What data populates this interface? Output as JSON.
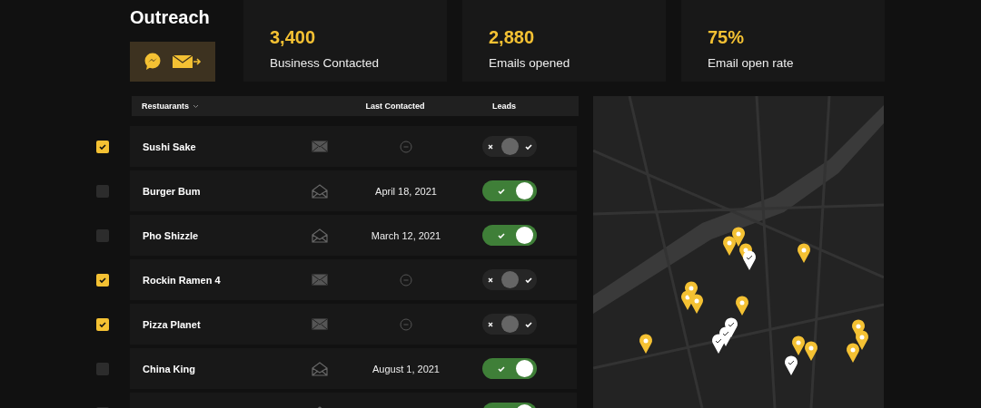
{
  "title": "Outreach",
  "stats": [
    {
      "value": "3,400",
      "label": "Business Contacted"
    },
    {
      "value": "2,880",
      "label": "Emails opened"
    },
    {
      "value": "75%",
      "label": "Email open rate"
    }
  ],
  "table": {
    "columns": [
      "Restuarants",
      "Last Contacted",
      "Leads"
    ],
    "rows": [
      {
        "checked": true,
        "name": "Sushi Sake",
        "opened": false,
        "last_contacted": null,
        "lead": false
      },
      {
        "checked": false,
        "name": "Burger Bum",
        "opened": true,
        "last_contacted": "April 18, 2021",
        "lead": true
      },
      {
        "checked": false,
        "name": "Pho Shizzle",
        "opened": true,
        "last_contacted": "March 12, 2021",
        "lead": true
      },
      {
        "checked": true,
        "name": "Rockin Ramen 4",
        "opened": false,
        "last_contacted": null,
        "lead": false
      },
      {
        "checked": true,
        "name": "Pizza Planet",
        "opened": false,
        "last_contacted": null,
        "lead": false
      },
      {
        "checked": false,
        "name": "China King",
        "opened": true,
        "last_contacted": "August 1, 2021",
        "lead": true
      },
      {
        "checked": false,
        "opened": true,
        "lead": true
      }
    ]
  }
}
